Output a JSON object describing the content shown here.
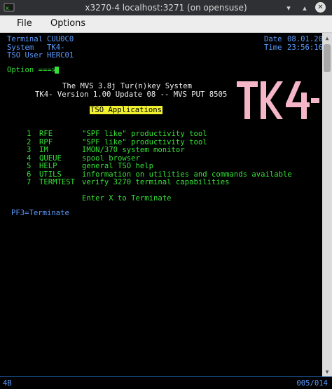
{
  "window": {
    "title": "x3270-4 localhost:3271 (on opensuse)",
    "min_glyph": "▾",
    "max_glyph": "▴",
    "close_glyph": "✕"
  },
  "menu": {
    "file": "File",
    "options": "Options"
  },
  "header": {
    "terminal_label": "Terminal",
    "terminal_value": "CUU0C0",
    "system_label": "System",
    "system_value": "TK4-",
    "tso_user_label": "TSO User",
    "tso_user_value": "HERC01",
    "date_label": "Date",
    "date_value": "08.01.20",
    "time_label": "Time",
    "time_value": "23:56:16"
  },
  "option_prompt": "Option ===>",
  "banner": {
    "line1": "The MVS 3.8j Tur(n)key System",
    "line2": "TK4- Version 1.00 Update 08 -- MVS PUT 8505",
    "tso_apps": "TSO Applications"
  },
  "logo_text": "TK4-",
  "applications": [
    {
      "num": "1",
      "name": "RFE",
      "desc": "\"SPF like\" productivity tool"
    },
    {
      "num": "2",
      "name": "RPF",
      "desc": "\"SPF like\" productivity tool"
    },
    {
      "num": "3",
      "name": "IM",
      "desc": "IMON/370 system monitor"
    },
    {
      "num": "4",
      "name": "QUEUE",
      "desc": "spool browser"
    },
    {
      "num": "5",
      "name": "HELP",
      "desc": "general TSO help"
    },
    {
      "num": "6",
      "name": "UTILS",
      "desc": "information on utilities and commands available"
    },
    {
      "num": "7",
      "name": "TERMTEST",
      "desc": "verify 3270 terminal capabilities"
    }
  ],
  "exit_hint": "Enter X to Terminate",
  "pf3": "PF3=Terminate",
  "status": {
    "indicator": "4B",
    "cursor_pos": "005/014"
  },
  "colors": {
    "blue": "#5b9bff",
    "green": "#35e035",
    "yellow": "#f0f030",
    "logo_pink": "#f5b6c8"
  }
}
